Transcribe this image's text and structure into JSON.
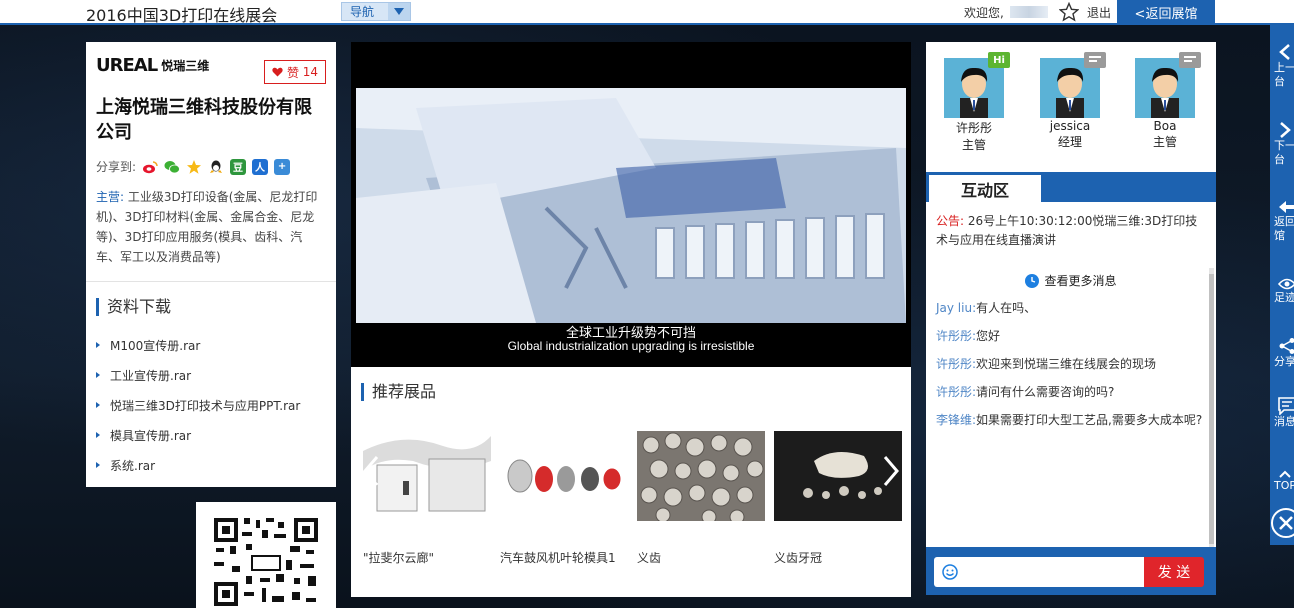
{
  "topbar": {
    "title": "2016中国3D打印在线展会",
    "nav_label": "导航",
    "welcome": "欢迎您,",
    "logout": "退出",
    "back_hall": "<返回展馆"
  },
  "company": {
    "logo_mark": "UREAL",
    "logo_cn": "悦瑞三维",
    "like_label": "赞",
    "like_count": "14",
    "name": "上海悦瑞三维科技股份有限公司",
    "share_label": "分享到:",
    "share_icons": [
      "weibo-icon",
      "wechat-icon",
      "qzone-icon",
      "qq-icon",
      "douban-icon",
      "renren-icon",
      "more-share-icon"
    ],
    "business_key": "主营:",
    "business_text": "工业级3D打印设备(金属、尼龙打印机)、3D打印材料(金属、金属合金、尼龙等)、3D打印应用服务(模具、齿科、汽车、军工以及消费品等)"
  },
  "downloads": {
    "heading": "资料下载",
    "items": [
      "M100宣传册.rar",
      "工业宣传册.rar",
      "悦瑞三维3D打印技术与应用PPT.rar",
      "模具宣传册.rar",
      "系统.rar"
    ]
  },
  "video": {
    "subtitle_cn": "全球工业升级势不可挡",
    "subtitle_en": "Global industrialization upgrading is irresistible"
  },
  "recommend": {
    "heading": "推荐展品",
    "products": [
      {
        "name": "\"拉斐尔云廊\""
      },
      {
        "name": "汽车鼓风机叶轮模具1"
      },
      {
        "name": "义齿"
      },
      {
        "name": "义齿牙冠"
      }
    ]
  },
  "agents": [
    {
      "name": "许彤彤",
      "role": "主管",
      "badge": "Hi",
      "badge_color": "#5cb531"
    },
    {
      "name": "jessica",
      "role": "经理",
      "badge": "",
      "badge_color": "#9a9a9a"
    },
    {
      "name": "Boa",
      "role": "主管",
      "badge": "",
      "badge_color": "#9a9a9a"
    }
  ],
  "chat": {
    "tab": "互动区",
    "notice_key": "公告:",
    "notice_text": "26号上午10:30:12:00悦瑞三维:3D打印技术与应用在线直播演讲",
    "more": "查看更多消息",
    "messages": [
      {
        "who": "Jay liu:",
        "text": "有人在吗、"
      },
      {
        "who": "许彤彤:",
        "text": "您好"
      },
      {
        "who": "许彤彤:",
        "text": "欢迎来到悦瑞三维在线展会的现场"
      },
      {
        "who": "许彤彤:",
        "text": "请问有什么需要咨询的吗?"
      },
      {
        "who": "李锋维:",
        "text": "如果需要打印大型工艺品,需要多大成本呢?"
      }
    ],
    "input_placeholder": "",
    "send": "发 送"
  },
  "tools": [
    {
      "label": "上一展台"
    },
    {
      "label": "下一展台"
    },
    {
      "label": "返回展馆"
    },
    {
      "label": "足迹"
    },
    {
      "label": "分享"
    },
    {
      "label": "消息"
    },
    {
      "label": "TOP"
    }
  ],
  "colors": {
    "accent": "#1d62b0",
    "red": "#d81e1e",
    "send": "#e0252b"
  }
}
